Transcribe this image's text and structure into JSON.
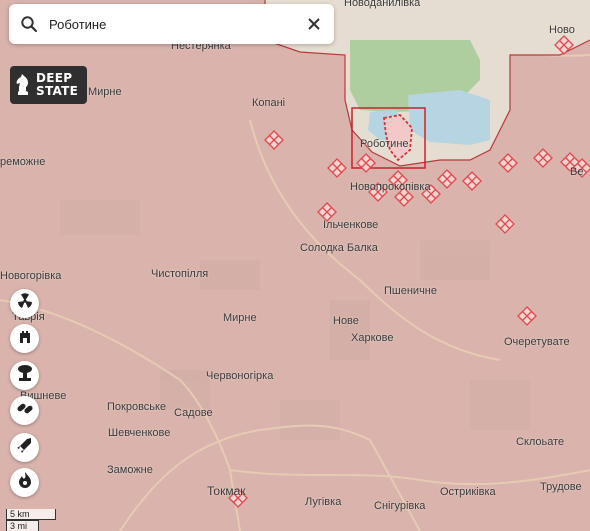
{
  "search": {
    "value": "Роботине",
    "placeholder": ""
  },
  "logo": {
    "line1": "DEEP",
    "line2": "STATE"
  },
  "places": {
    "novodanylivka": "Новоданилівка",
    "nesteryanka": "Нестерянка",
    "novo_right": "Ново",
    "myrne_nw": "Мирне",
    "kopani": "Копані",
    "robotyne": "Роботине",
    "peremozhne": "реможне",
    "novoprokopivka": "Новопрокопівка",
    "ilchenkove": "Ільченкове",
    "solodka_balka": "Солодка Балка",
    "novohorivka": "Новогорівка",
    "chystopillia": "Чистопілля",
    "pshenychne": "Пшеничне",
    "tavria": "Таврія",
    "myrne": "Мирне",
    "nove": "Нове",
    "kharkove": "Харкове",
    "ocheretuvate": "Очеретувате",
    "chervonohirka": "Червоногірка",
    "pokrovske": "Покровське",
    "sadove": "Садове",
    "vyshneve": "Вишневе",
    "shevchenkove": "Шевченкове",
    "sklovate": "Склоьате",
    "zamozhne": "Заможне",
    "tokmak": "Токмак",
    "luhivka": "Лугівка",
    "snihurivka": "Снігурівка",
    "ostrykivka": "Остриківка",
    "trudove": "Трудове",
    "ve": "Ве"
  },
  "scale": {
    "km": "5 km",
    "mi": "3 mi"
  },
  "tools": [
    "radiation-icon",
    "fortification-icon",
    "explosion-icon",
    "pills-icon",
    "missile-icon",
    "fire-icon"
  ],
  "colors": {
    "occupied": "#d9b3ac",
    "liberated_green": "#a8cc9a",
    "water": "#b7d4e3",
    "front_line": "#b53b3b",
    "marker": "#e2474b"
  }
}
